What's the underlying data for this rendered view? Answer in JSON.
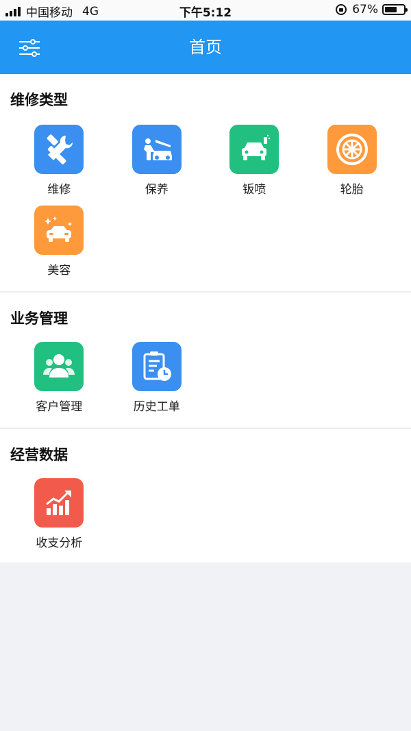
{
  "status_bar": {
    "carrier": "中国移动",
    "network": "4G",
    "time": "下午5:12",
    "battery": "67%",
    "battery_level": 0.67
  },
  "header": {
    "title": "首页",
    "menu_icon": "sliders-icon"
  },
  "sections": [
    {
      "title": "维修类型",
      "items": [
        {
          "label": "维修",
          "icon": "tools-icon",
          "color": "#3a8ff0"
        },
        {
          "label": "保养",
          "icon": "car-hood-service-icon",
          "color": "#3a8ff0"
        },
        {
          "label": "钣喷",
          "icon": "car-spray-icon",
          "color": "#22c080"
        },
        {
          "label": "轮胎",
          "icon": "tire-icon",
          "color": "#ff9a3c"
        },
        {
          "label": "美容",
          "icon": "car-sparkle-icon",
          "color": "#ff9a3c"
        }
      ]
    },
    {
      "title": "业务管理",
      "items": [
        {
          "label": "客户管理",
          "icon": "users-icon",
          "color": "#22c080"
        },
        {
          "label": "历史工单",
          "icon": "clipboard-clock-icon",
          "color": "#3a8ff0"
        }
      ]
    },
    {
      "title": "经营数据",
      "items": [
        {
          "label": "收支分析",
          "icon": "bar-chart-up-icon",
          "color": "#f25b4b"
        }
      ]
    }
  ]
}
